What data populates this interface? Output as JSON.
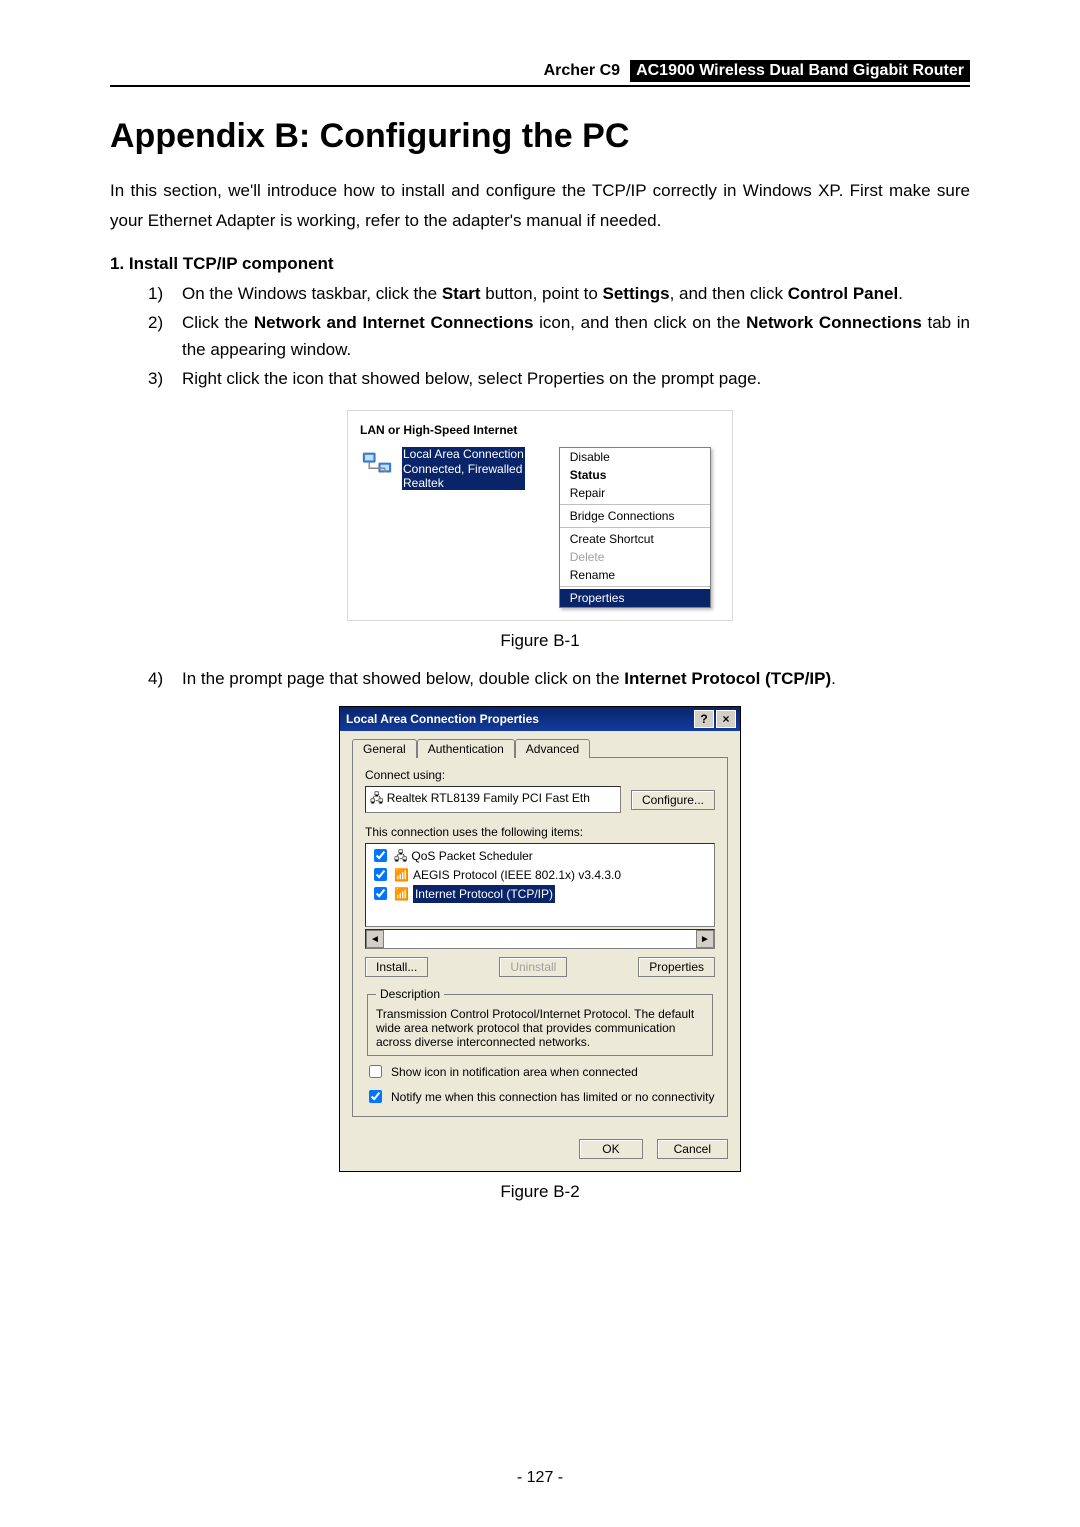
{
  "header": {
    "model": "Archer C9",
    "product": "AC1900 Wireless Dual Band Gigabit Router"
  },
  "title": "Appendix B: Configuring the PC",
  "intro": "In this section, we'll introduce how to install and configure the TCP/IP correctly in Windows XP. First make sure your Ethernet Adapter is working, refer to the adapter's manual if needed.",
  "section1": {
    "number": "1.",
    "heading": "Install TCP/IP component",
    "steps": {
      "s1": {
        "num": "1)",
        "pre": "On the Windows taskbar, click the ",
        "b1": "Start",
        "mid1": " button, point to ",
        "b2": "Settings",
        "mid2": ", and then click ",
        "b3": "Control Panel",
        "post": "."
      },
      "s2": {
        "num": "2)",
        "pre": "Click the ",
        "b1": "Network and Internet Connections",
        "mid1": " icon, and then click on the ",
        "b2": "Network Connections",
        "post": " tab in the appearing window."
      },
      "s3": {
        "num": "3)",
        "text": "Right click the icon that showed below, select Properties on the prompt page."
      },
      "s4": {
        "num": "4)",
        "pre": "In the prompt page that showed below, double click on the ",
        "b1": "Internet Protocol (TCP/IP)",
        "post": "."
      }
    }
  },
  "fig1": {
    "caption": "Figure B-1",
    "groupbox": "LAN or High-Speed Internet",
    "conn": {
      "name": "Local Area Connection",
      "status": "Connected, Firewalled",
      "adapter": "Realtek"
    },
    "menu": {
      "disable": "Disable",
      "status": "Status",
      "repair": "Repair",
      "bridge": "Bridge Connections",
      "shortcut": "Create Shortcut",
      "delete": "Delete",
      "rename": "Rename",
      "properties": "Properties"
    }
  },
  "fig2": {
    "caption": "Figure B-2",
    "title": "Local Area Connection   Properties",
    "help": "?",
    "close": "×",
    "tabs": {
      "general": "General",
      "auth": "Authentication",
      "adv": "Advanced"
    },
    "connect_using": "Connect using:",
    "adapter": "Realtek RTL8139 Family PCI Fast Eth",
    "configure": "Configure...",
    "uses_items": "This connection uses the following items:",
    "items": {
      "qos": "QoS Packet Scheduler",
      "aegis": "AEGIS Protocol (IEEE 802.1x) v3.4.3.0",
      "tcpip": "Internet Protocol (TCP/IP)"
    },
    "install": "Install...",
    "uninstall": "Uninstall",
    "properties": "Properties",
    "desc_legend": "Description",
    "description": "Transmission Control Protocol/Internet Protocol. The default wide area network protocol that provides communication across diverse interconnected networks.",
    "show_icon": "Show icon in notification area when connected",
    "notify": "Notify me when this connection has limited or no connectivity",
    "ok": "OK",
    "cancel": "Cancel"
  },
  "page_number": "- 127 -"
}
